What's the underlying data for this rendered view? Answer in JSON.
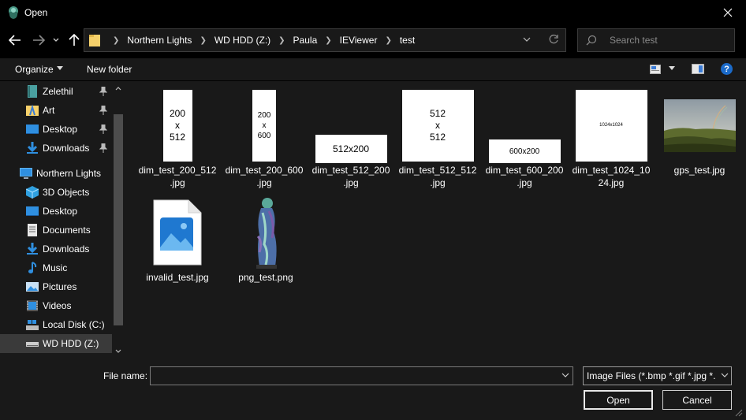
{
  "window": {
    "title": "Open"
  },
  "address": {
    "crumbs": [
      "Northern Lights",
      "WD HDD (Z:)",
      "Paula",
      "IEViewer",
      "test"
    ]
  },
  "search": {
    "placeholder": "Search test"
  },
  "toolbar": {
    "organize": "Organize",
    "new_folder": "New folder",
    "help": "?"
  },
  "sidebar": {
    "quick_access": [
      {
        "label": "Zelethil",
        "icon": "book-icon",
        "pinned": true
      },
      {
        "label": "Art",
        "icon": "art-folder-icon",
        "pinned": true
      },
      {
        "label": "Desktop",
        "icon": "desktop-icon",
        "pinned": true
      },
      {
        "label": "Downloads",
        "icon": "download-icon",
        "pinned": true
      }
    ],
    "this_pc": {
      "label": "Northern Lights",
      "icon": "computer-icon"
    },
    "items": [
      {
        "label": "3D Objects",
        "icon": "cube-icon"
      },
      {
        "label": "Desktop",
        "icon": "desktop-icon"
      },
      {
        "label": "Documents",
        "icon": "document-icon"
      },
      {
        "label": "Downloads",
        "icon": "download-icon"
      },
      {
        "label": "Music",
        "icon": "music-icon"
      },
      {
        "label": "Pictures",
        "icon": "pictures-icon"
      },
      {
        "label": "Videos",
        "icon": "video-icon"
      },
      {
        "label": "Local Disk (C:)",
        "icon": "local-disk-icon"
      },
      {
        "label": "WD HDD (Z:)",
        "icon": "drive-icon",
        "selected": true
      }
    ]
  },
  "files": [
    {
      "name1": "dim_test_200_512",
      "name2": ".jpg",
      "thumb_text": [
        "200",
        "x",
        "512"
      ]
    },
    {
      "name1": "dim_test_200_600",
      "name2": ".jpg",
      "thumb_text": [
        "200",
        "x",
        "600"
      ]
    },
    {
      "name1": "dim_test_512_200",
      "name2": ".jpg",
      "thumb_text": [
        "512x200"
      ]
    },
    {
      "name1": "dim_test_512_512",
      "name2": ".jpg",
      "thumb_text": [
        "512",
        "x",
        "512"
      ]
    },
    {
      "name1": "dim_test_600_200",
      "name2": ".jpg",
      "thumb_text": [
        "600x200"
      ]
    },
    {
      "name1": "dim_test_1024_10",
      "name2": "24.jpg",
      "thumb_text": [
        "1024x1024"
      ]
    },
    {
      "name1": "gps_test.jpg",
      "name2": "",
      "thumb_text": []
    },
    {
      "name1": "invalid_test.jpg",
      "name2": "",
      "thumb_text": []
    },
    {
      "name1": "png_test.png",
      "name2": "",
      "thumb_text": []
    }
  ],
  "bottom": {
    "file_name_label": "File name:",
    "file_name_value": "",
    "file_type": "Image Files (*.bmp *.gif *.jpg *.",
    "open_label": "Open",
    "cancel_label": "Cancel"
  },
  "colors": {
    "background": "#191919",
    "accent": "#1b6ac9",
    "folder": "#f6d16b"
  }
}
